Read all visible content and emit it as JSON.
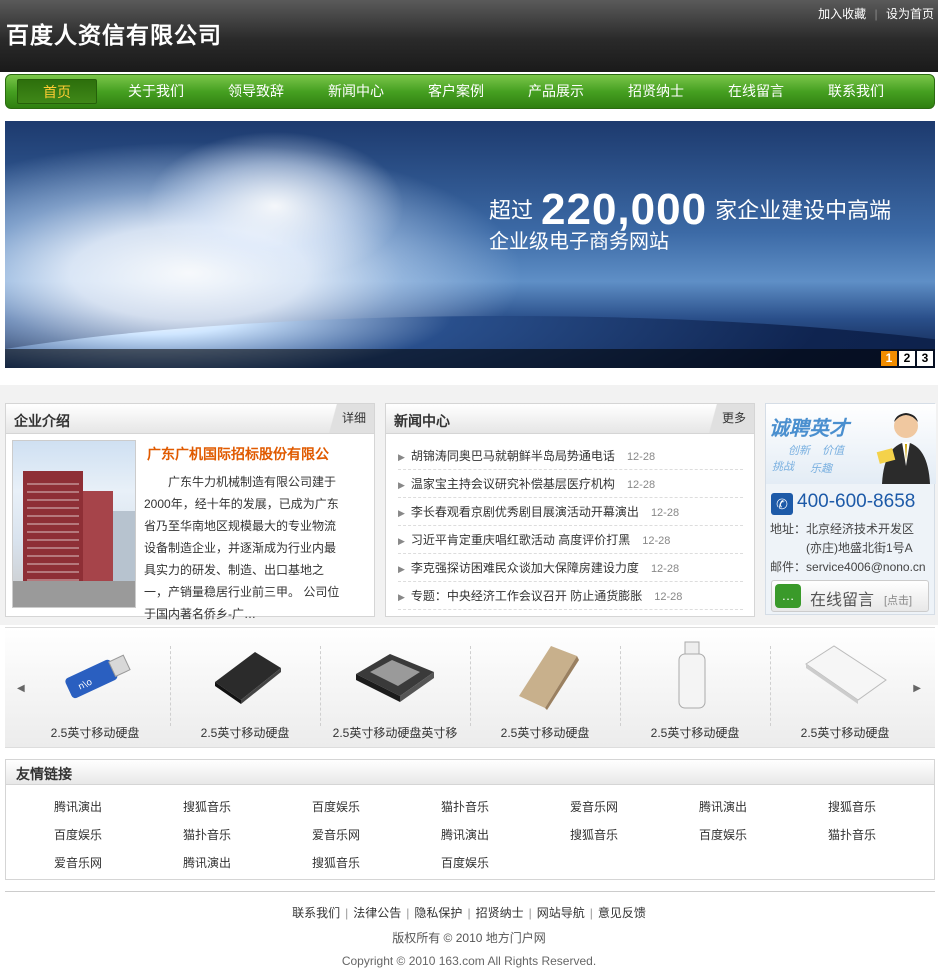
{
  "header": {
    "site_title": "百度人资信有限公司",
    "add_favorite": "加入收藏",
    "set_homepage": "设为首页",
    "separator": "|"
  },
  "nav": {
    "items": [
      "首页",
      "关于我们",
      "领导致辞",
      "新闻中心",
      "客户案例",
      "产品展示",
      "招贤纳士",
      "在线留言",
      "联系我们"
    ],
    "active_index": 0
  },
  "banner": {
    "line1_prefix": "超过",
    "line1_number": "220,000",
    "line1_suffix": "家企业建设中高端",
    "line2": "企业级电子商务网站",
    "slides": [
      "1",
      "2",
      "3"
    ],
    "active_slide": "1"
  },
  "intro": {
    "title": "企业介绍",
    "more": "详细",
    "company_name": "广东广机国际招标股份有限公",
    "description": "广东牛力机械制造有限公司建于2000年，经十年的发展，已成为广东省乃至华南地区规模最大的专业物流设备制造企业，并逐渐成为行业内最具实力的研发、制造、出口基地之一，产销量稳居行业前三甲。 公司位于国内著名侨乡-广…"
  },
  "news": {
    "title": "新闻中心",
    "more": "更多",
    "items": [
      {
        "title": "胡锦涛同奥巴马就朝鲜半岛局势通电话",
        "date": "12-28"
      },
      {
        "title": "温家宝主持会议研究补偿基层医疗机构",
        "date": "12-28"
      },
      {
        "title": "李长春观看京剧优秀剧目展演活动开幕演出",
        "date": "12-28"
      },
      {
        "title": "习近平肯定重庆唱红歌活动 高度评价打黑",
        "date": "12-28"
      },
      {
        "title": "李克强探访困难民众谈加大保障房建设力度",
        "date": "12-28"
      },
      {
        "title": "专题：中央经济工作会议召开 防止通货膨胀",
        "date": "12-28"
      }
    ]
  },
  "recruit": {
    "title": "诚聘英才",
    "words": [
      "创新",
      "价值",
      "挑战",
      "乐趣"
    ],
    "phone": "400-600-8658",
    "address_label": "地址：",
    "address_line1": "北京经济技术开发区",
    "address_line2": "(亦庄)地盛北街1号A",
    "email_label": "邮件：",
    "email": "service4006@nono.cn",
    "message_label": "在线留言",
    "message_sub": "[点击]"
  },
  "products": {
    "prev": "◀",
    "next": "▶",
    "items": [
      {
        "label": "2.5英寸移动硬盘",
        "color": "#2a5fc0"
      },
      {
        "label": "2.5英寸移动硬盘",
        "color": "#2b2b2b"
      },
      {
        "label": "2.5英寸移动硬盘英寸移",
        "color": "#3a3a3a"
      },
      {
        "label": "2.5英寸移动硬盘",
        "color": "#c8b08c"
      },
      {
        "label": "2.5英寸移动硬盘",
        "color": "#e8e8e8"
      },
      {
        "label": "2.5英寸移动硬盘",
        "color": "#f0f0f0"
      }
    ]
  },
  "friend_links": {
    "title": "友情链接",
    "items": [
      "腾讯演出",
      "搜狐音乐",
      "百度娱乐",
      "猫扑音乐",
      "爱音乐网",
      "腾讯演出",
      "搜狐音乐",
      "百度娱乐",
      "猫扑音乐",
      "爱音乐网",
      "腾讯演出",
      "搜狐音乐",
      "百度娱乐",
      "猫扑音乐",
      "爱音乐网",
      "腾讯演出",
      "搜狐音乐",
      "百度娱乐"
    ]
  },
  "footer": {
    "links": [
      "联系我们",
      "法律公告",
      "隐私保护",
      "招贤纳士",
      "网站导航",
      "意见反馈"
    ],
    "separator": "|",
    "copyright_cn": "版权所有 © 2010 地方门户网",
    "copyright_en": "Copyright © 2010 163.com All Rights Reserved."
  }
}
